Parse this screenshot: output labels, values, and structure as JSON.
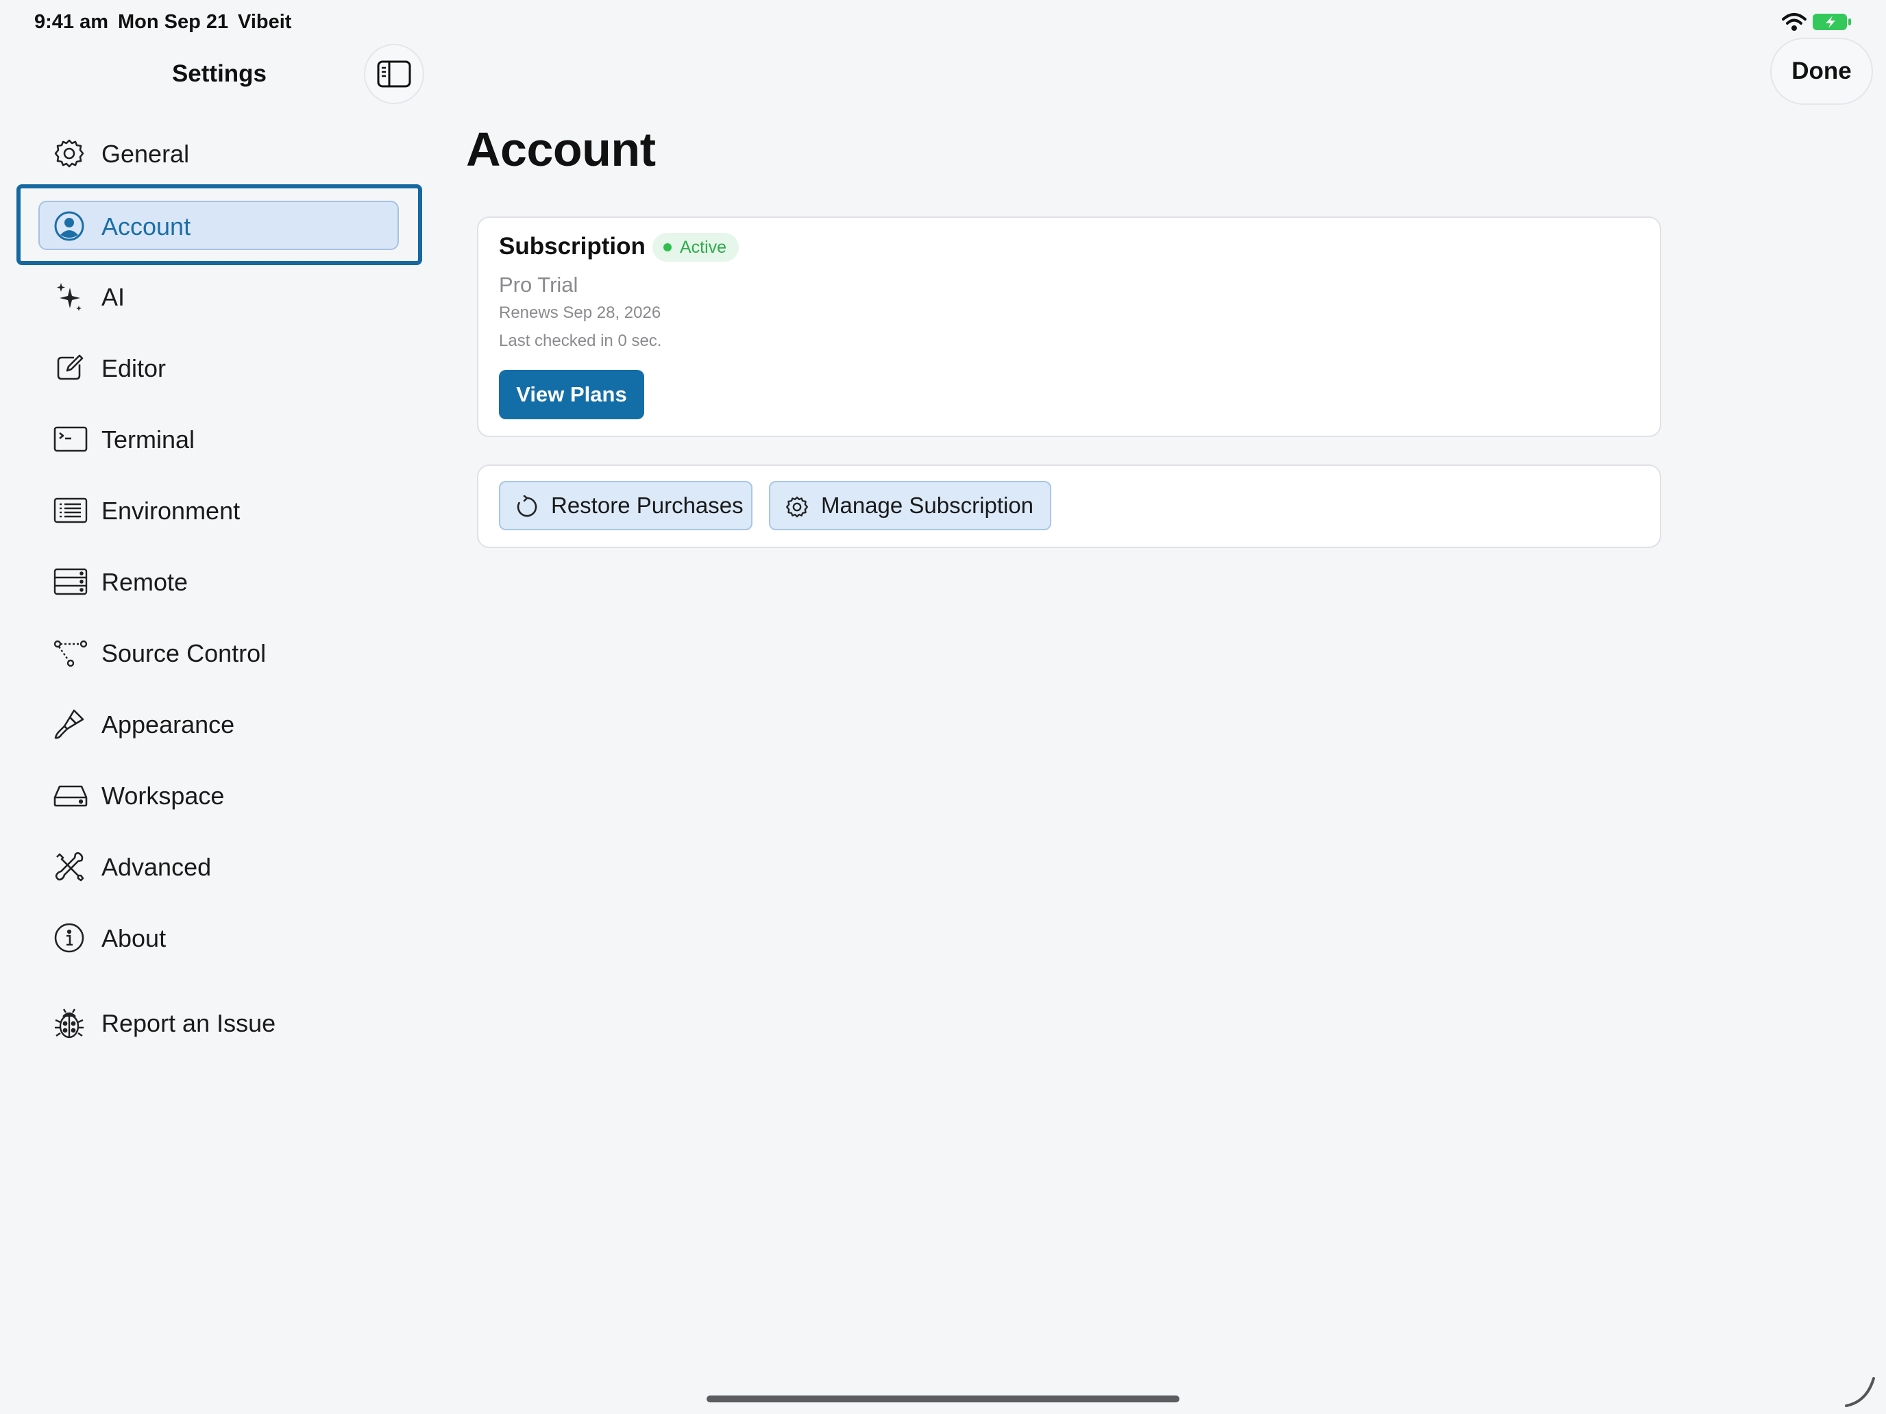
{
  "status_bar": {
    "time": "9:41 am",
    "date": "Mon Sep 21",
    "app": "Vibeit"
  },
  "header": {
    "sidebar_title": "Settings",
    "done_label": "Done"
  },
  "sidebar": {
    "items": [
      {
        "label": "General",
        "icon": "gear-icon"
      },
      {
        "label": "Account",
        "icon": "person-circle-icon",
        "selected": true
      },
      {
        "label": "AI",
        "icon": "sparkles-icon"
      },
      {
        "label": "Editor",
        "icon": "square-pencil-icon"
      },
      {
        "label": "Terminal",
        "icon": "terminal-icon"
      },
      {
        "label": "Environment",
        "icon": "list-rectangle-icon"
      },
      {
        "label": "Remote",
        "icon": "server-rack-icon"
      },
      {
        "label": "Source Control",
        "icon": "branch-icon"
      },
      {
        "label": "Appearance",
        "icon": "paintbrush-icon"
      },
      {
        "label": "Workspace",
        "icon": "drive-icon"
      },
      {
        "label": "Advanced",
        "icon": "wrench-screwdriver-icon"
      },
      {
        "label": "About",
        "icon": "info-circle-icon"
      },
      {
        "label": "Report an Issue",
        "icon": "ladybug-icon"
      }
    ]
  },
  "main": {
    "title": "Account",
    "subscription": {
      "title": "Subscription",
      "status": "Active",
      "plan": "Pro Trial",
      "renews": "Renews Sep 28, 2026",
      "last_checked": "Last checked in 0 sec.",
      "view_plans_label": "View Plans"
    },
    "actions": {
      "restore_label": "Restore Purchases",
      "manage_label": "Manage Subscription"
    }
  },
  "colors": {
    "accent": "#136ea8",
    "selection": "#d8e6f7",
    "active_green": "#2fbf4f"
  }
}
